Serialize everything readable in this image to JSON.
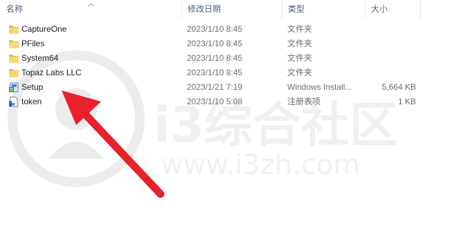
{
  "columns": {
    "name": "名称",
    "date": "修改日期",
    "type": "类型",
    "size": "大小"
  },
  "files": [
    {
      "name": "CaptureOne",
      "date": "2023/1/10 8:45",
      "type": "文件夹",
      "size": "",
      "icon": "folder-icon"
    },
    {
      "name": "PFiles",
      "date": "2023/1/10 8:45",
      "type": "文件夹",
      "size": "",
      "icon": "folder-icon"
    },
    {
      "name": "System64",
      "date": "2023/1/10 8:45",
      "type": "文件夹",
      "size": "",
      "icon": "folder-icon"
    },
    {
      "name": "Topaz Labs LLC",
      "date": "2023/1/10 8:45",
      "type": "文件夹",
      "size": "",
      "icon": "folder-icon"
    },
    {
      "name": "Setup",
      "date": "2023/1/21 7:19",
      "type": "Windows Install...",
      "size": "5,664 KB",
      "icon": "installer-icon"
    },
    {
      "name": "token",
      "date": "2023/1/10 5:08",
      "type": "注册表项",
      "size": "1 KB",
      "icon": "registry-file-icon"
    }
  ],
  "watermark": {
    "brand": "i3综合社区",
    "url": "www.i3zh.com"
  },
  "annotation": {
    "color": "#e8212b",
    "icon": "red-arrow-pointer"
  }
}
